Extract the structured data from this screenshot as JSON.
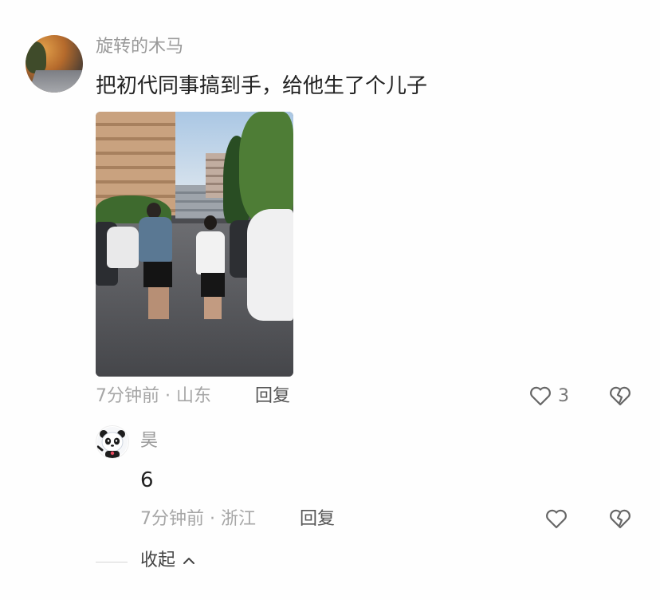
{
  "comment": {
    "username": "旋转的木马",
    "text": "把初代同事搞到手，给他生了个儿子",
    "meta": "7分钟前 · 山东",
    "reply_label": "回复",
    "like_count": "3",
    "like_icon": "heart-outline-icon",
    "dislike_icon": "broken-heart-icon"
  },
  "reply": {
    "username": "昊",
    "text": "6",
    "meta": "7分钟前 · 浙江",
    "reply_label": "回复",
    "like_icon": "heart-outline-icon",
    "dislike_icon": "broken-heart-icon"
  },
  "collapse": {
    "label": "收起",
    "icon": "chevron-up-icon"
  }
}
